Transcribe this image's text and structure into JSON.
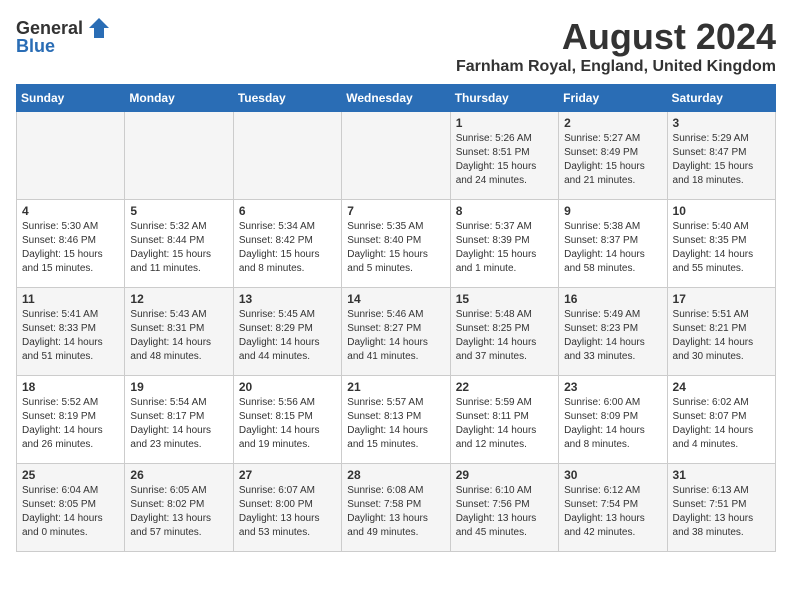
{
  "header": {
    "logo_general": "General",
    "logo_blue": "Blue",
    "month_year": "August 2024",
    "location": "Farnham Royal, England, United Kingdom"
  },
  "weekdays": [
    "Sunday",
    "Monday",
    "Tuesday",
    "Wednesday",
    "Thursday",
    "Friday",
    "Saturday"
  ],
  "weeks": [
    [
      {
        "day": "",
        "text": ""
      },
      {
        "day": "",
        "text": ""
      },
      {
        "day": "",
        "text": ""
      },
      {
        "day": "",
        "text": ""
      },
      {
        "day": "1",
        "text": "Sunrise: 5:26 AM\nSunset: 8:51 PM\nDaylight: 15 hours\nand 24 minutes."
      },
      {
        "day": "2",
        "text": "Sunrise: 5:27 AM\nSunset: 8:49 PM\nDaylight: 15 hours\nand 21 minutes."
      },
      {
        "day": "3",
        "text": "Sunrise: 5:29 AM\nSunset: 8:47 PM\nDaylight: 15 hours\nand 18 minutes."
      }
    ],
    [
      {
        "day": "4",
        "text": "Sunrise: 5:30 AM\nSunset: 8:46 PM\nDaylight: 15 hours\nand 15 minutes."
      },
      {
        "day": "5",
        "text": "Sunrise: 5:32 AM\nSunset: 8:44 PM\nDaylight: 15 hours\nand 11 minutes."
      },
      {
        "day": "6",
        "text": "Sunrise: 5:34 AM\nSunset: 8:42 PM\nDaylight: 15 hours\nand 8 minutes."
      },
      {
        "day": "7",
        "text": "Sunrise: 5:35 AM\nSunset: 8:40 PM\nDaylight: 15 hours\nand 5 minutes."
      },
      {
        "day": "8",
        "text": "Sunrise: 5:37 AM\nSunset: 8:39 PM\nDaylight: 15 hours\nand 1 minute."
      },
      {
        "day": "9",
        "text": "Sunrise: 5:38 AM\nSunset: 8:37 PM\nDaylight: 14 hours\nand 58 minutes."
      },
      {
        "day": "10",
        "text": "Sunrise: 5:40 AM\nSunset: 8:35 PM\nDaylight: 14 hours\nand 55 minutes."
      }
    ],
    [
      {
        "day": "11",
        "text": "Sunrise: 5:41 AM\nSunset: 8:33 PM\nDaylight: 14 hours\nand 51 minutes."
      },
      {
        "day": "12",
        "text": "Sunrise: 5:43 AM\nSunset: 8:31 PM\nDaylight: 14 hours\nand 48 minutes."
      },
      {
        "day": "13",
        "text": "Sunrise: 5:45 AM\nSunset: 8:29 PM\nDaylight: 14 hours\nand 44 minutes."
      },
      {
        "day": "14",
        "text": "Sunrise: 5:46 AM\nSunset: 8:27 PM\nDaylight: 14 hours\nand 41 minutes."
      },
      {
        "day": "15",
        "text": "Sunrise: 5:48 AM\nSunset: 8:25 PM\nDaylight: 14 hours\nand 37 minutes."
      },
      {
        "day": "16",
        "text": "Sunrise: 5:49 AM\nSunset: 8:23 PM\nDaylight: 14 hours\nand 33 minutes."
      },
      {
        "day": "17",
        "text": "Sunrise: 5:51 AM\nSunset: 8:21 PM\nDaylight: 14 hours\nand 30 minutes."
      }
    ],
    [
      {
        "day": "18",
        "text": "Sunrise: 5:52 AM\nSunset: 8:19 PM\nDaylight: 14 hours\nand 26 minutes."
      },
      {
        "day": "19",
        "text": "Sunrise: 5:54 AM\nSunset: 8:17 PM\nDaylight: 14 hours\nand 23 minutes."
      },
      {
        "day": "20",
        "text": "Sunrise: 5:56 AM\nSunset: 8:15 PM\nDaylight: 14 hours\nand 19 minutes."
      },
      {
        "day": "21",
        "text": "Sunrise: 5:57 AM\nSunset: 8:13 PM\nDaylight: 14 hours\nand 15 minutes."
      },
      {
        "day": "22",
        "text": "Sunrise: 5:59 AM\nSunset: 8:11 PM\nDaylight: 14 hours\nand 12 minutes."
      },
      {
        "day": "23",
        "text": "Sunrise: 6:00 AM\nSunset: 8:09 PM\nDaylight: 14 hours\nand 8 minutes."
      },
      {
        "day": "24",
        "text": "Sunrise: 6:02 AM\nSunset: 8:07 PM\nDaylight: 14 hours\nand 4 minutes."
      }
    ],
    [
      {
        "day": "25",
        "text": "Sunrise: 6:04 AM\nSunset: 8:05 PM\nDaylight: 14 hours\nand 0 minutes."
      },
      {
        "day": "26",
        "text": "Sunrise: 6:05 AM\nSunset: 8:02 PM\nDaylight: 13 hours\nand 57 minutes."
      },
      {
        "day": "27",
        "text": "Sunrise: 6:07 AM\nSunset: 8:00 PM\nDaylight: 13 hours\nand 53 minutes."
      },
      {
        "day": "28",
        "text": "Sunrise: 6:08 AM\nSunset: 7:58 PM\nDaylight: 13 hours\nand 49 minutes."
      },
      {
        "day": "29",
        "text": "Sunrise: 6:10 AM\nSunset: 7:56 PM\nDaylight: 13 hours\nand 45 minutes."
      },
      {
        "day": "30",
        "text": "Sunrise: 6:12 AM\nSunset: 7:54 PM\nDaylight: 13 hours\nand 42 minutes."
      },
      {
        "day": "31",
        "text": "Sunrise: 6:13 AM\nSunset: 7:51 PM\nDaylight: 13 hours\nand 38 minutes."
      }
    ]
  ]
}
